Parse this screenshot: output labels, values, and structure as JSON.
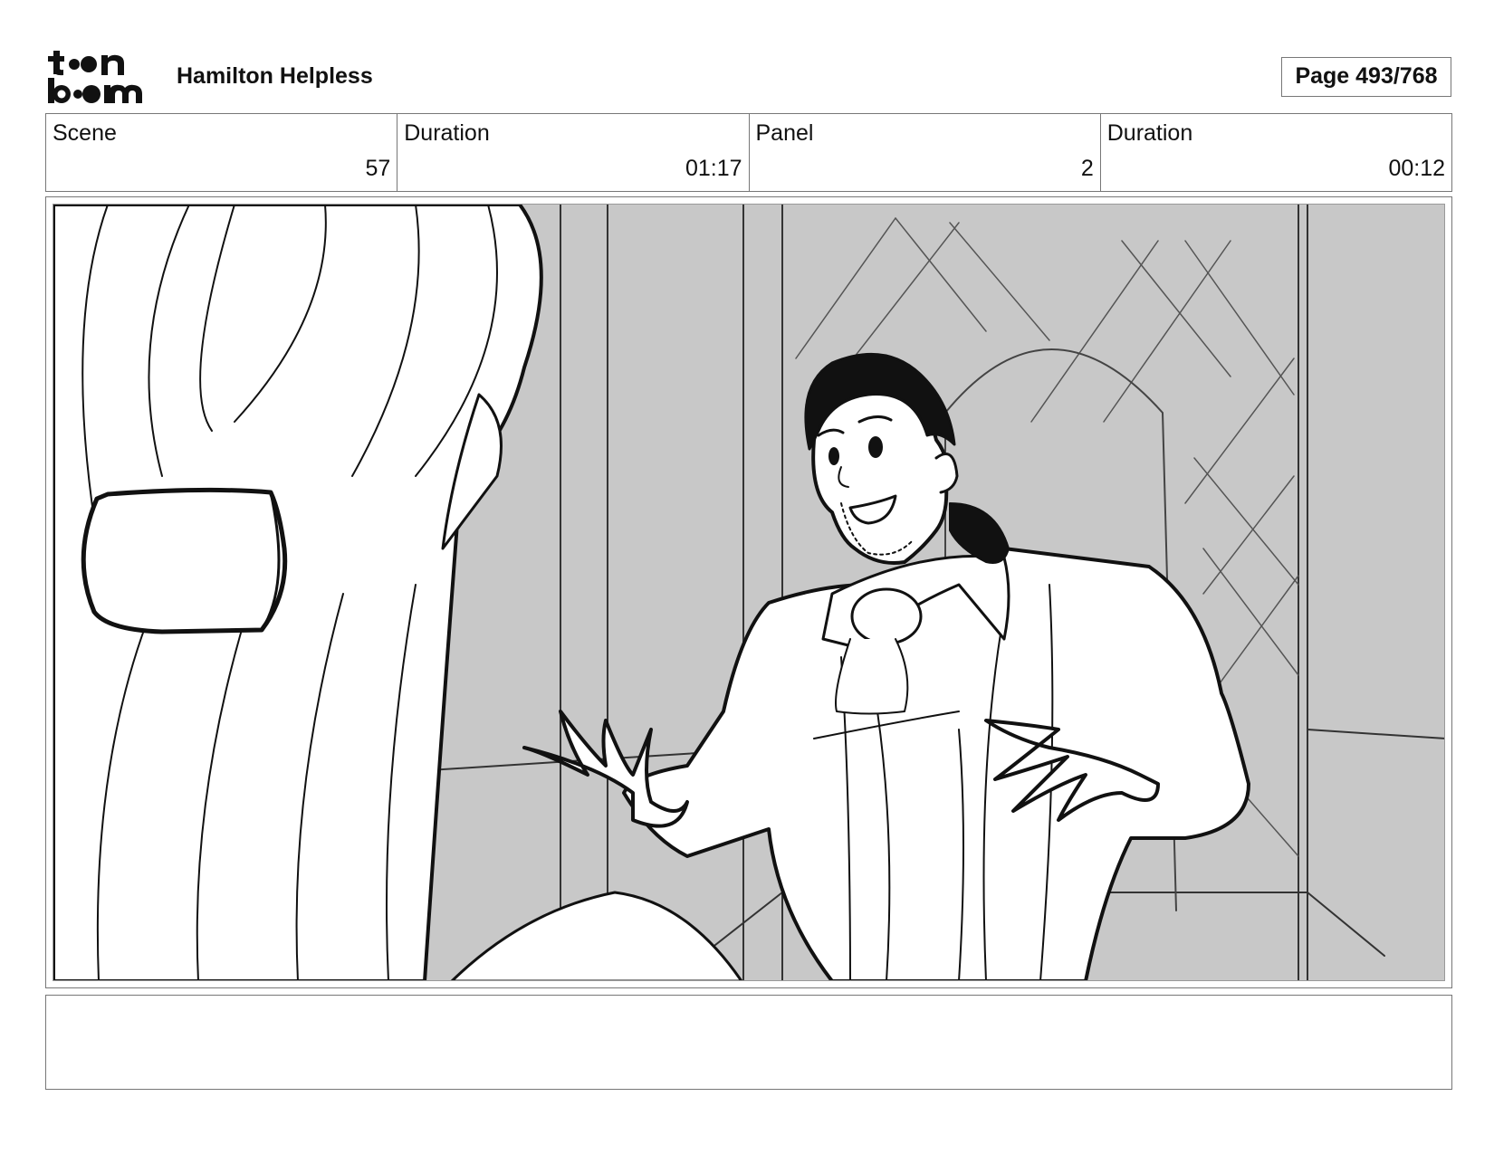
{
  "header": {
    "logo_text_top": "toon",
    "logo_text_bottom": "boom",
    "project_title": "Hamilton Helpless",
    "page_label": "Page 493/768"
  },
  "info": [
    {
      "label": "Scene",
      "value": "57"
    },
    {
      "label": "Duration",
      "value": "01:17"
    },
    {
      "label": "Panel",
      "value": "2"
    },
    {
      "label": "Duration",
      "value": "00:12"
    }
  ],
  "panel": {
    "description": "",
    "background_color": "#c8c8c8",
    "line_color": "#111111"
  },
  "notes": {
    "text": ""
  }
}
